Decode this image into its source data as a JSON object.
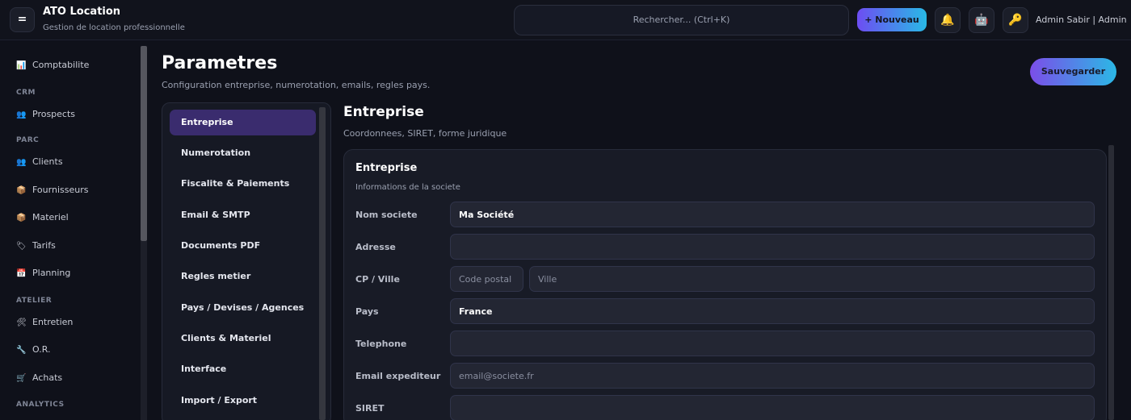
{
  "app": {
    "title": "ATO Location",
    "subtitle": "Gestion de location professionnelle",
    "menu_glyph": "="
  },
  "topbar": {
    "search_placeholder": "Rechercher... (Ctrl+K)",
    "new_label": "+ Nouveau",
    "user_label": "Admin Sabir | Admin",
    "icons": [
      "bell-icon",
      "robot-icon",
      "key-icon"
    ]
  },
  "sidebar": {
    "items": [
      {
        "label": "Comptabilite",
        "icon": "chart-icon",
        "glyph": "📊"
      },
      {
        "section": "CRM"
      },
      {
        "label": "Prospects",
        "icon": "people-icon",
        "glyph": "👥"
      },
      {
        "section": "PARC"
      },
      {
        "label": "Clients",
        "icon": "people-icon",
        "glyph": "👥"
      },
      {
        "label": "Fournisseurs",
        "icon": "package-icon",
        "glyph": "📦"
      },
      {
        "label": "Materiel",
        "icon": "package-icon",
        "glyph": "📦"
      },
      {
        "label": "Tarifs",
        "icon": "tag-icon",
        "glyph": "🏷"
      },
      {
        "label": "Planning",
        "icon": "calendar-icon",
        "glyph": "📅"
      },
      {
        "section": "ATELIER"
      },
      {
        "label": "Entretien",
        "icon": "tools-icon",
        "glyph": "🛠"
      },
      {
        "label": "O.R.",
        "icon": "wrench-icon",
        "glyph": "🔧"
      },
      {
        "label": "Achats",
        "icon": "cart-icon",
        "glyph": "🛒"
      },
      {
        "section": "ANALYTICS"
      }
    ]
  },
  "page": {
    "title": "Parametres",
    "subtitle": "Configuration entreprise, numerotation, emails, regles pays.",
    "save_label": "Sauvegarder"
  },
  "settings_nav": [
    "Entreprise",
    "Numerotation",
    "Fiscalite & Paiements",
    "Email & SMTP",
    "Documents PDF",
    "Regles metier",
    "Pays / Devises / Agences",
    "Clients & Materiel",
    "Interface",
    "Import / Export"
  ],
  "section": {
    "title": "Entreprise",
    "subtitle": "Coordonnees, SIRET, forme juridique"
  },
  "card": {
    "title": "Entreprise",
    "subtitle": "Informations de la societe"
  },
  "form": {
    "nom_label": "Nom societe",
    "nom_value": "Ma Société",
    "adresse_label": "Adresse",
    "cpville_label": "CP / Ville",
    "cp_placeholder": "Code postal",
    "ville_placeholder": "Ville",
    "pays_label": "Pays",
    "pays_value": "France",
    "telephone_label": "Telephone",
    "email_label": "Email expediteur",
    "email_placeholder": "email@societe.fr",
    "siret_label": "SIRET"
  }
}
